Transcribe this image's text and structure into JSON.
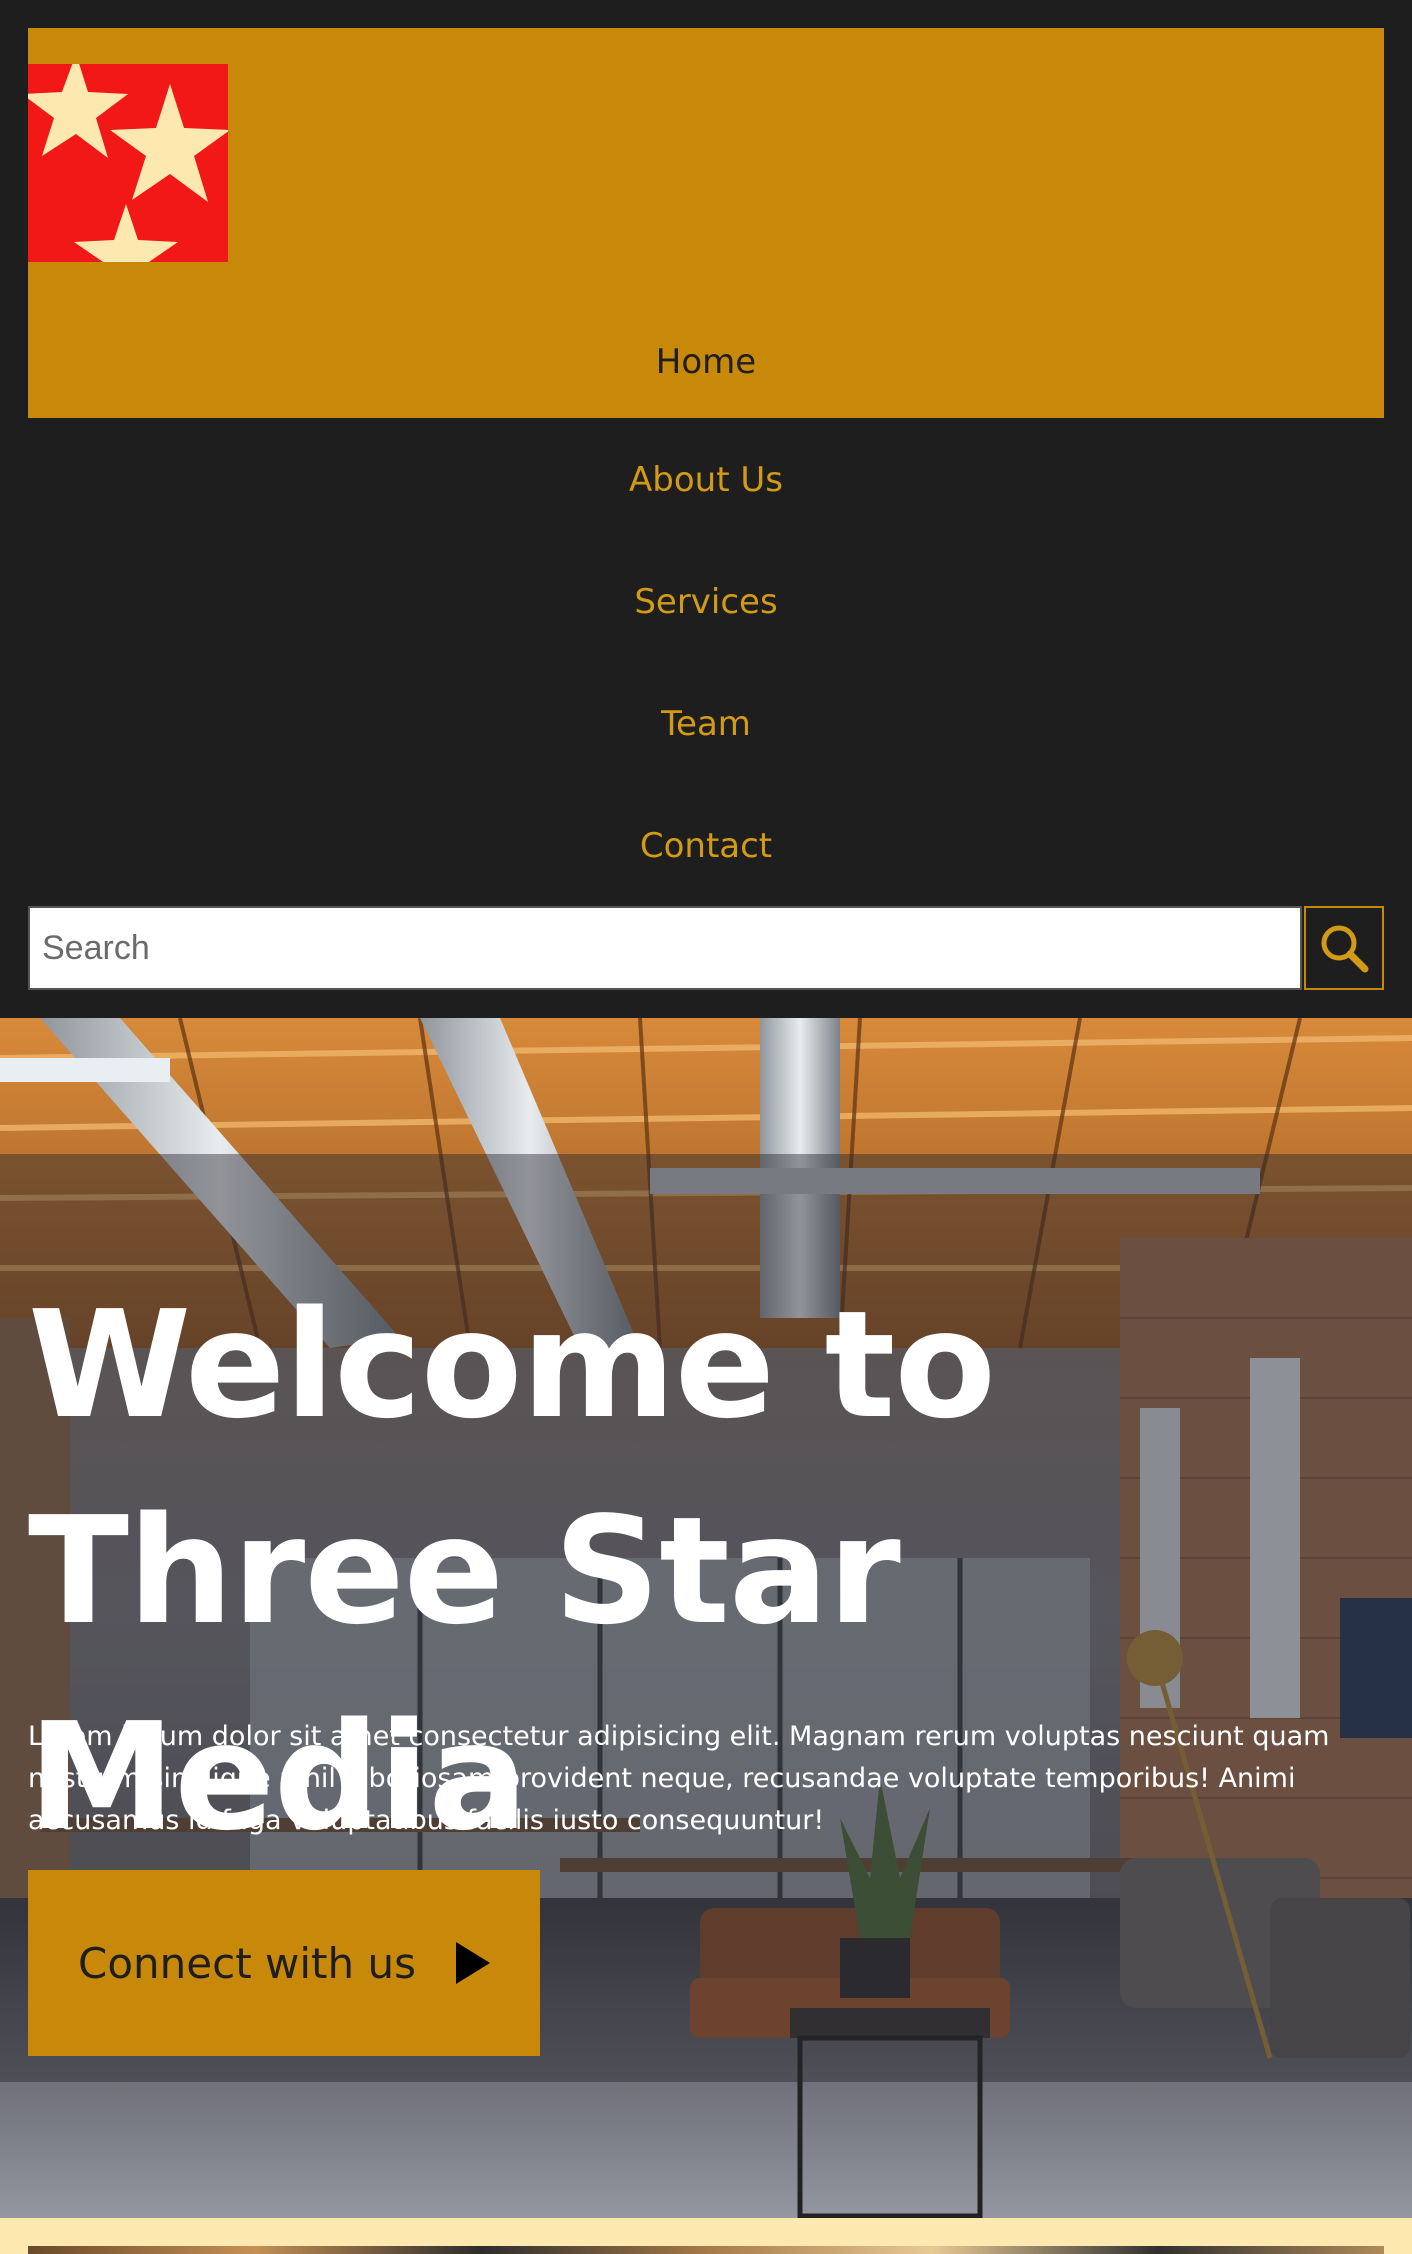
{
  "brand": {
    "logo_name": "three-star-logo",
    "colors": {
      "accent": "#c8890a",
      "dark": "#1e1e1f",
      "logo_red": "#f31818",
      "star": "#fde9b0"
    }
  },
  "nav": {
    "items": [
      {
        "label": "Home",
        "active": true
      },
      {
        "label": "About Us"
      },
      {
        "label": "Services"
      },
      {
        "label": "Team"
      },
      {
        "label": "Contact"
      }
    ]
  },
  "search": {
    "placeholder": "Search",
    "button_icon": "search-icon"
  },
  "hero": {
    "title": "Welcome to Three Star Media",
    "text": "Lorem ipsum dolor sit amet consectetur adipisicing elit. Magnam rerum voluptas nesciunt quam nostrum similique nihil laboriosam provident neque, recusandae voluptate temporibus! Animi accusamus id fuga voluptatibus facilis iusto consequuntur!",
    "cta_label": "Connect with us",
    "cta_icon": "play-triangle-icon"
  }
}
